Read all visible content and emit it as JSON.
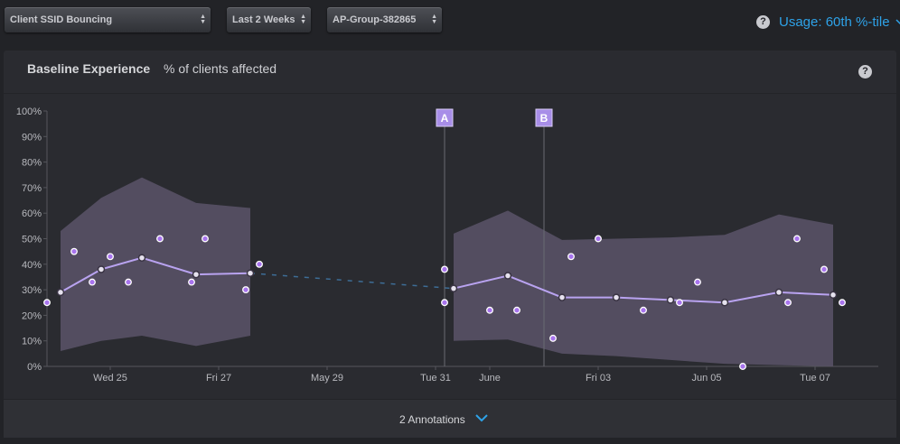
{
  "filters": [
    {
      "label": "Client SSID Bouncing"
    },
    {
      "label": "Last 2 Weeks"
    },
    {
      "label": "AP-Group-382865"
    }
  ],
  "usage_label": "Usage: 60th %-tile",
  "panel": {
    "title": "Baseline Experience",
    "subtitle": "% of clients affected",
    "annotations_label": "2 Annotations"
  },
  "colors": {
    "accent": "#2ea2e8",
    "median_line": "#b9a3f0",
    "band": "#5a5468",
    "point": "#a874ee",
    "marker": "#a88ee8"
  },
  "chart_data": {
    "type": "line",
    "title": "Baseline Experience",
    "subtitle": "% of clients affected",
    "ylim": [
      0,
      100
    ],
    "xlim": [
      "2016-05-23T20:00",
      "2016-06-08T04:00"
    ],
    "y_ticks": [
      0,
      10,
      20,
      30,
      40,
      50,
      60,
      70,
      80,
      90,
      100
    ],
    "y_tick_labels": [
      "0%",
      "10%",
      "20%",
      "30%",
      "40%",
      "50%",
      "60%",
      "70%",
      "80%",
      "90%",
      "100%"
    ],
    "x_ticks": [
      {
        "x": "2016-05-25T00:00",
        "label": "Wed 25"
      },
      {
        "x": "2016-05-27T00:00",
        "label": "Fri 27"
      },
      {
        "x": "2016-05-29T00:00",
        "label": "May 29"
      },
      {
        "x": "2016-05-31T00:00",
        "label": "Tue 31"
      },
      {
        "x": "2016-06-01T00:00",
        "label": "June"
      },
      {
        "x": "2016-06-03T00:00",
        "label": "Fri 03"
      },
      {
        "x": "2016-06-05T00:00",
        "label": "Jun 05"
      },
      {
        "x": "2016-06-07T00:00",
        "label": "Tue 07"
      }
    ],
    "grid": false,
    "series": [
      {
        "kind": "median",
        "segments": [
          [
            [
              "2016-05-24T02:00",
              29
            ],
            [
              "2016-05-24T20:00",
              38
            ],
            [
              "2016-05-25T14:00",
              42.5
            ],
            [
              "2016-05-26T14:00",
              36
            ],
            [
              "2016-05-27T14:00",
              36.5
            ]
          ],
          [
            [
              "2016-05-31T08:00",
              30.5
            ],
            [
              "2016-06-01T08:00",
              35.5
            ],
            [
              "2016-06-02T08:00",
              27
            ],
            [
              "2016-06-03T08:00",
              27
            ],
            [
              "2016-06-04T08:00",
              26
            ],
            [
              "2016-06-05T08:00",
              25
            ],
            [
              "2016-06-06T08:00",
              29
            ],
            [
              "2016-06-07T08:00",
              28
            ]
          ]
        ],
        "gap": [
          [
            "2016-05-27T14:00",
            36.5
          ],
          [
            "2016-05-31T08:00",
            30.5
          ]
        ]
      },
      {
        "kind": "band",
        "segments": [
          [
            [
              "2016-05-24T02:00",
              6,
              53
            ],
            [
              "2016-05-24T20:00",
              10,
              66
            ],
            [
              "2016-05-25T14:00",
              12,
              74
            ],
            [
              "2016-05-26T14:00",
              8,
              64
            ],
            [
              "2016-05-27T14:00",
              12,
              62
            ]
          ],
          [
            [
              "2016-05-31T08:00",
              10,
              52
            ],
            [
              "2016-06-01T08:00",
              10.5,
              61
            ],
            [
              "2016-06-02T08:00",
              5,
              49.5
            ],
            [
              "2016-06-03T08:00",
              4,
              50
            ],
            [
              "2016-06-04T08:00",
              2.5,
              50.5
            ],
            [
              "2016-06-05T08:00",
              1,
              51.5
            ],
            [
              "2016-06-06T08:00",
              0.5,
              59.5
            ],
            [
              "2016-06-07T08:00",
              0,
              55.5
            ]
          ]
        ]
      },
      {
        "kind": "points",
        "values": [
          [
            "2016-05-23T20:00",
            25
          ],
          [
            "2016-05-24T08:00",
            45
          ],
          [
            "2016-05-24T16:00",
            33
          ],
          [
            "2016-05-25T00:00",
            43
          ],
          [
            "2016-05-25T08:00",
            33
          ],
          [
            "2016-05-25T22:00",
            50
          ],
          [
            "2016-05-26T12:00",
            33
          ],
          [
            "2016-05-26T18:00",
            50
          ],
          [
            "2016-05-27T12:00",
            30
          ],
          [
            "2016-05-27T18:00",
            40
          ],
          [
            "2016-05-31T04:00",
            38
          ],
          [
            "2016-05-31T04:00",
            25
          ],
          [
            "2016-06-01T00:00",
            22
          ],
          [
            "2016-06-01T12:00",
            22
          ],
          [
            "2016-06-02T04:00",
            11
          ],
          [
            "2016-06-02T12:00",
            43
          ],
          [
            "2016-06-03T00:00",
            50
          ],
          [
            "2016-06-03T20:00",
            22
          ],
          [
            "2016-06-04T12:00",
            25
          ],
          [
            "2016-06-04T20:00",
            33
          ],
          [
            "2016-06-05T16:00",
            0
          ],
          [
            "2016-06-06T12:00",
            25
          ],
          [
            "2016-06-06T16:00",
            50
          ],
          [
            "2016-06-07T04:00",
            38
          ],
          [
            "2016-06-07T12:00",
            25
          ]
        ]
      }
    ],
    "markers": [
      {
        "label": "A",
        "x": "2016-05-31T04:00"
      },
      {
        "label": "B",
        "x": "2016-06-02T00:00"
      }
    ]
  }
}
